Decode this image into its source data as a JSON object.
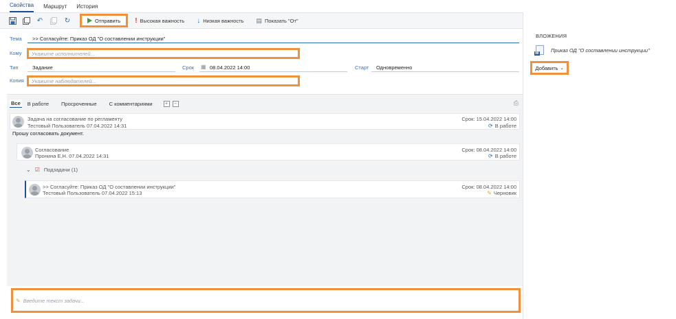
{
  "tabs": [
    "Свойства",
    "Маршрут",
    "История"
  ],
  "toolbar": {
    "send_label": "Отправить",
    "high_label": "Высокая важность",
    "low_label": "Низкая важность",
    "show_from_label": "Показать \"От\""
  },
  "form": {
    "subject_label": "Тема",
    "subject_value": ">> Согласуйте: Приказ ОД \"О составлении инструкции\"",
    "to_label": "Кому",
    "to_placeholder": "Укажите исполнителей...",
    "type_label": "Тип",
    "type_value": "Задание",
    "due_label": "Срок",
    "due_value": "08.04.2022 14:00",
    "start_label": "Старт",
    "start_value": "Одновременно",
    "cc_label": "Копия",
    "cc_placeholder": "Укажите наблюдателей..."
  },
  "attachments": {
    "title": "ВЛОЖЕНИЯ",
    "file": "Приказ ОД \"О составлении инструкции\"",
    "add_label": "Добавить"
  },
  "filters": [
    "Все",
    "В работе",
    "Просроченные",
    "С комментариями"
  ],
  "feed": {
    "items": [
      {
        "title": "Задача на согласование по регламенту",
        "author": "Тестовый Пользователь  07.04.2022 14:31",
        "due": "Срок: 15.04.2022 14:00",
        "status": "В работе",
        "body": "Прошу согласовать документ."
      },
      {
        "title": "Согласование",
        "author": "Пронина Е.Н.  07.04.2022 14:31",
        "due": "Срок: 08.04.2022 14:00",
        "status": "В работе"
      },
      {
        "title": ">> Согласуйте: Приказ ОД \"О составлении инструкции\"",
        "author": "Тестовый Пользователь  07.04.2022 15:13",
        "due": "Срок: 08.04.2022 14:00",
        "status": "Черновик"
      }
    ],
    "subtasks_label": "Подзадачи (1)"
  },
  "editor": {
    "placeholder": "Введите текст задачи..."
  }
}
